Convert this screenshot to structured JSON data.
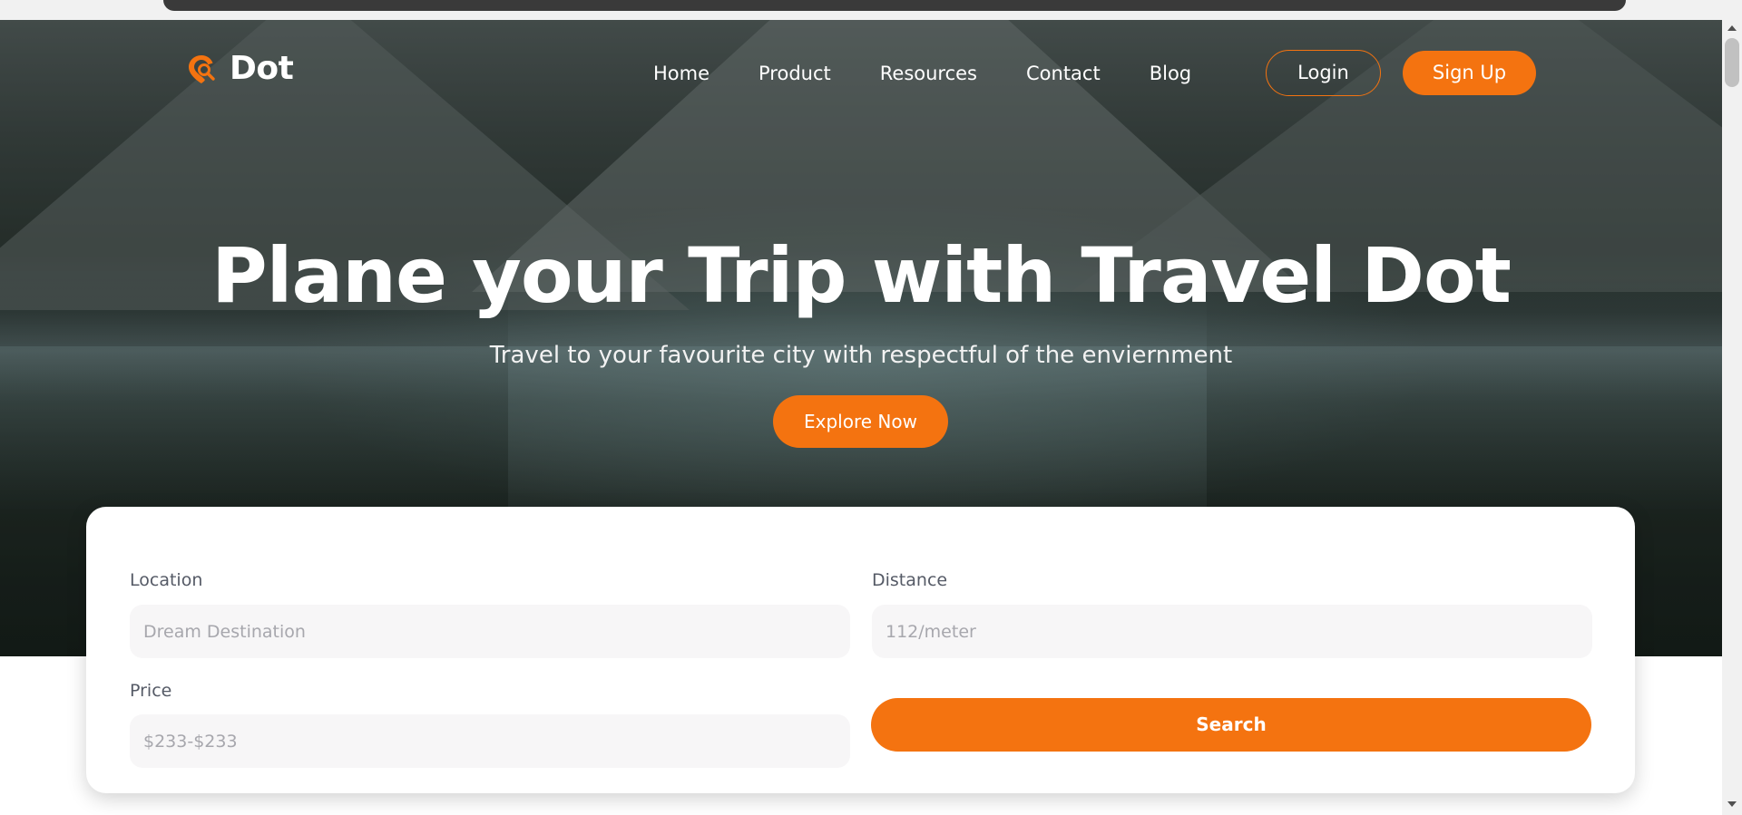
{
  "brand": {
    "name": "Dot",
    "logo_icon": "map-search-icon",
    "accent": "#f47310"
  },
  "nav": {
    "links": [
      "Home",
      "Product",
      "Resources",
      "Contact",
      "Blog"
    ],
    "login_label": "Login",
    "signup_label": "Sign Up"
  },
  "hero": {
    "title": "Plane your Trip with Travel Dot",
    "subtitle": "Travel to your favourite city with respectful of the enviernment",
    "cta_label": "Explore Now"
  },
  "search_form": {
    "location": {
      "label": "Location",
      "placeholder": "Dream Destination"
    },
    "distance": {
      "label": "Distance",
      "placeholder": "112/meter"
    },
    "price": {
      "label": "Price",
      "placeholder": "$233-$233"
    },
    "submit_label": "Search"
  }
}
